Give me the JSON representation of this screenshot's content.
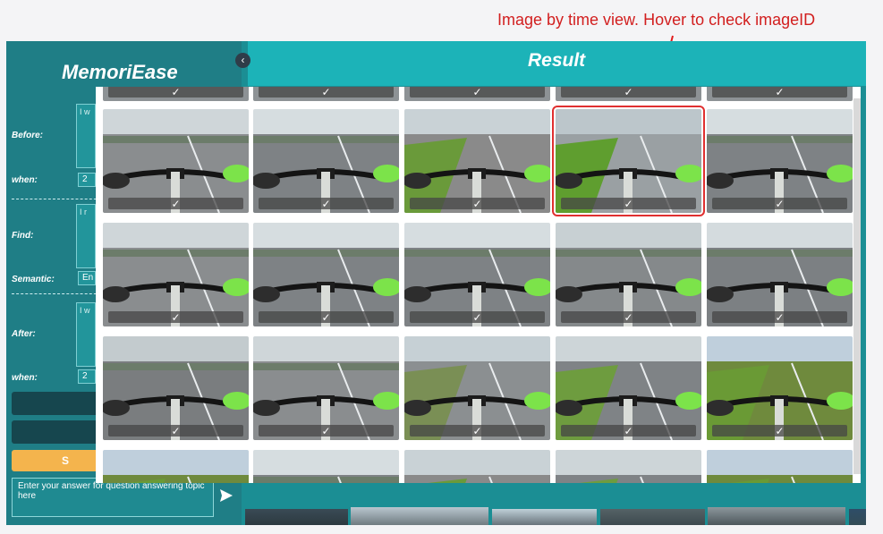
{
  "annotation": {
    "text": "Image by time view. Hover to check imageID",
    "color": "#d21f1f"
  },
  "app": {
    "logo": "MemoriEase",
    "collapse_icon": "‹",
    "result_title": "Result"
  },
  "sidebar": {
    "before_label": "Before:",
    "before_value": "I w",
    "before_when_label": "when:",
    "before_when_value": "2",
    "find_label": "Find:",
    "find_value": "I r",
    "semantic_label": "Semantic:",
    "semantic_value": "En",
    "after_label": "After:",
    "after_value": "I w",
    "after_when_label": "when:",
    "after_when_value": "2",
    "orange_button_label": "S",
    "answer_placeholder": "Enter your answer for question answering topic here"
  },
  "gallery": {
    "icon_check": "check-icon",
    "rows": [
      [
        "road-left",
        "road-straight",
        "path-green",
        "grass-kerb",
        "road-straight"
      ],
      [
        "road-left",
        "road-straight",
        "road-straight",
        "bus-lane",
        "road-cars"
      ],
      [
        "road-yellow",
        "road-left",
        "junction",
        "path-park",
        "park"
      ],
      [
        "park",
        "road-straight",
        "path-green",
        "path-park",
        "park"
      ]
    ],
    "selected": [
      0,
      3
    ]
  }
}
